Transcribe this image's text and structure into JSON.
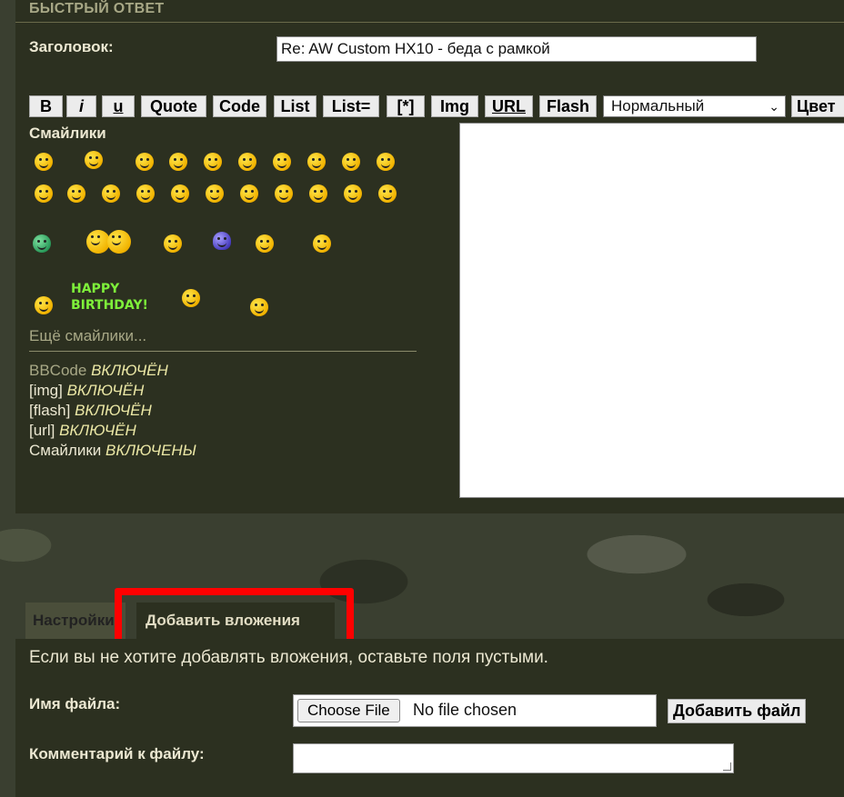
{
  "section_title": "БЫСТРЫЙ ОТВЕТ",
  "subject": {
    "label": "Заголовок:",
    "value": "Re: AW Custom HX10 - беда с рамкой"
  },
  "toolbar": {
    "bold": "B",
    "italic": "i",
    "underline": "u",
    "quote": "Quote",
    "code": "Code",
    "list": "List",
    "list_eq": "List=",
    "list_item": "[*]",
    "img": "Img",
    "url": "URL",
    "flash": "Flash",
    "size_select": "Нормальный",
    "color": "Цвет"
  },
  "smilies": {
    "label": "Смайлики",
    "more": "Ещё смайлики...",
    "birthday_line1": "HAPPY",
    "birthday_line2": "BIRTHDAY!"
  },
  "status": {
    "bbcode_label": "BBCode",
    "bbcode_state": "ВКЛЮЧЁН",
    "img_label": "[img]",
    "img_state": "ВКЛЮЧЁН",
    "flash_label": "[flash]",
    "flash_state": "ВКЛЮЧЁН",
    "url_label": "[url]",
    "url_state": "ВКЛЮЧЁН",
    "smilies_label": "Смайлики",
    "smilies_state": "ВКЛЮЧЕНЫ"
  },
  "tabs": {
    "settings": "Настройки",
    "attachments": "Добавить вложения"
  },
  "attachments": {
    "hint": "Если вы не хотите добавлять вложения, оставьте поля пустыми.",
    "file_label": "Имя файла:",
    "choose_file": "Choose File",
    "no_file": "No file chosen",
    "add_file": "Добавить файл",
    "comment_label": "Комментарий к файлу:"
  },
  "colors": {
    "highlight": "#ff0000",
    "panel": "#2c3020",
    "accent_text": "#a8a886"
  }
}
